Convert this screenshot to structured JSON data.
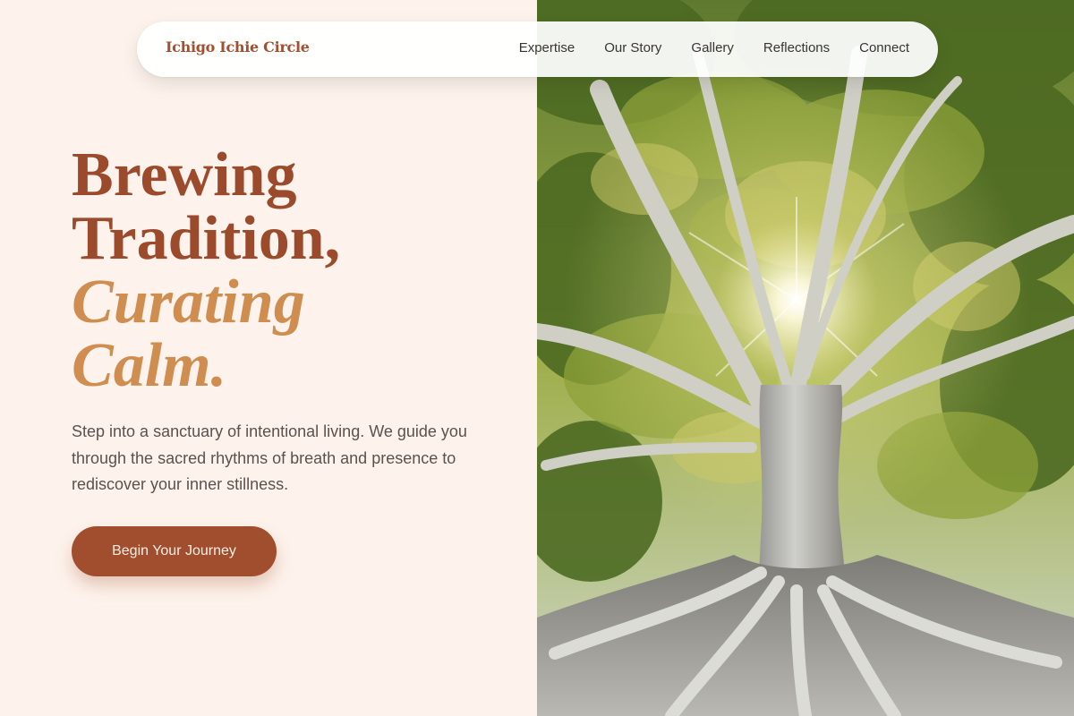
{
  "brand": {
    "name": "Ichigo Ichie Circle"
  },
  "nav": {
    "items": [
      {
        "label": "Expertise"
      },
      {
        "label": "Our Story"
      },
      {
        "label": "Gallery"
      },
      {
        "label": "Reflections"
      },
      {
        "label": "Connect"
      }
    ]
  },
  "hero": {
    "title_line1": "Brewing",
    "title_line2": "Tradition,",
    "title_line3": "Curating",
    "title_line4": "Calm.",
    "description": "Step into a sanctuary of intentional living. We guide you through the sacred rhythms of breath and presence to rediscover your inner stillness.",
    "cta_label": "Begin Your Journey"
  },
  "colors": {
    "background": "#fdf3ec",
    "primary": "#9b4a2c",
    "accent": "#cf8d4f",
    "button": "#a04e2e",
    "text": "#5a524d"
  }
}
